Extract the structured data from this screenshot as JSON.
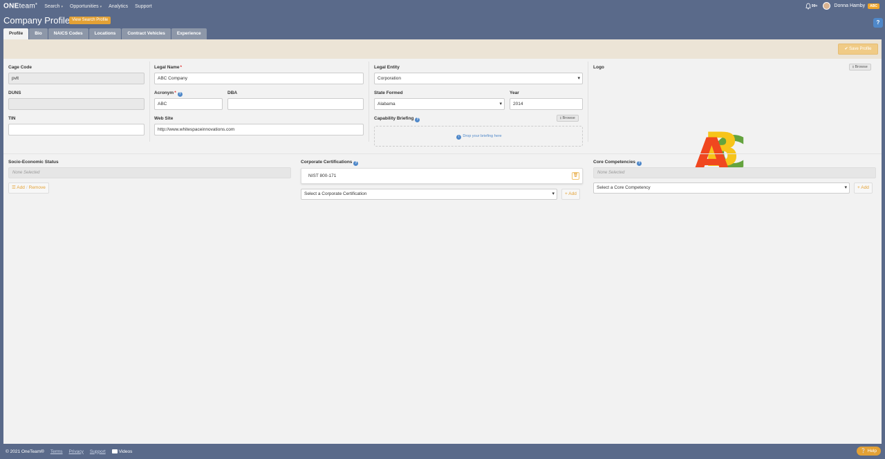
{
  "nav": {
    "brand_bold": "ONE",
    "brand_light": "team",
    "brand_mark": "®",
    "items": [
      {
        "label": "Search",
        "caret": true
      },
      {
        "label": "Opportunities",
        "caret": true
      },
      {
        "label": "Analytics",
        "caret": false
      },
      {
        "label": "Support",
        "caret": false
      }
    ],
    "notif_count": "99+",
    "user_name": "Donna Hamby",
    "user_badge": "ABC"
  },
  "header": {
    "title": "Company Profile",
    "view_button": "View Search Profile",
    "help_icon": "?"
  },
  "tabs": [
    {
      "label": "Profile",
      "active": true
    },
    {
      "label": "Bio",
      "active": false
    },
    {
      "label": "NAICS Codes",
      "active": false
    },
    {
      "label": "Locations",
      "active": false
    },
    {
      "label": "Contract Vehicles",
      "active": false
    },
    {
      "label": "Experience",
      "active": false
    }
  ],
  "toolbar": {
    "save_label": "Save Profile"
  },
  "form": {
    "cage_code": {
      "label": "Cage Code",
      "value": "pvlt"
    },
    "duns": {
      "label": "DUNS",
      "value": ""
    },
    "tin": {
      "label": "TIN",
      "value": ""
    },
    "legal_name": {
      "label": "Legal Name",
      "value": "ABC Company"
    },
    "acronym": {
      "label": "Acronym",
      "value": "ABC"
    },
    "dba": {
      "label": "DBA",
      "value": ""
    },
    "website": {
      "label": "Web Site",
      "value": "http://www.whitespaceinnovations.com"
    },
    "legal_entity": {
      "label": "Legal Entity",
      "value": "Corporation"
    },
    "state_formed": {
      "label": "State Formed",
      "value": "Alabama"
    },
    "year": {
      "label": "Year",
      "value": "2014"
    },
    "capability": {
      "label": "Capability Briefing",
      "browse": "Browse",
      "drop_text": "Drop your briefing here"
    },
    "logo": {
      "label": "Logo",
      "browse": "Browse",
      "letters": [
        "A",
        "B",
        "C"
      ]
    }
  },
  "socio": {
    "label": "Socio-Economic Status",
    "none": "None Selected",
    "add": "Add",
    "remove": "Remove"
  },
  "certs": {
    "label": "Corporate Certifications",
    "items": [
      "NIST 800-171"
    ],
    "select_placeholder": "Select a Corporate Certification",
    "add": "Add"
  },
  "competencies": {
    "label": "Core Competencies",
    "none": "None Selected",
    "select_placeholder": "Select a Core Competency",
    "add": "Add"
  },
  "footer": {
    "copyright": "© 2021 OneTeam®",
    "links": [
      "Terms",
      "Privacy",
      "Support"
    ],
    "videos": "Videos",
    "help": "Help"
  },
  "colors": {
    "accent": "#e3a135",
    "info": "#4f88c9",
    "nav_bg": "#5a6a8a",
    "logo_a": "#f0471f",
    "logo_b": "#f7c41a",
    "logo_c": "#64a33e"
  }
}
